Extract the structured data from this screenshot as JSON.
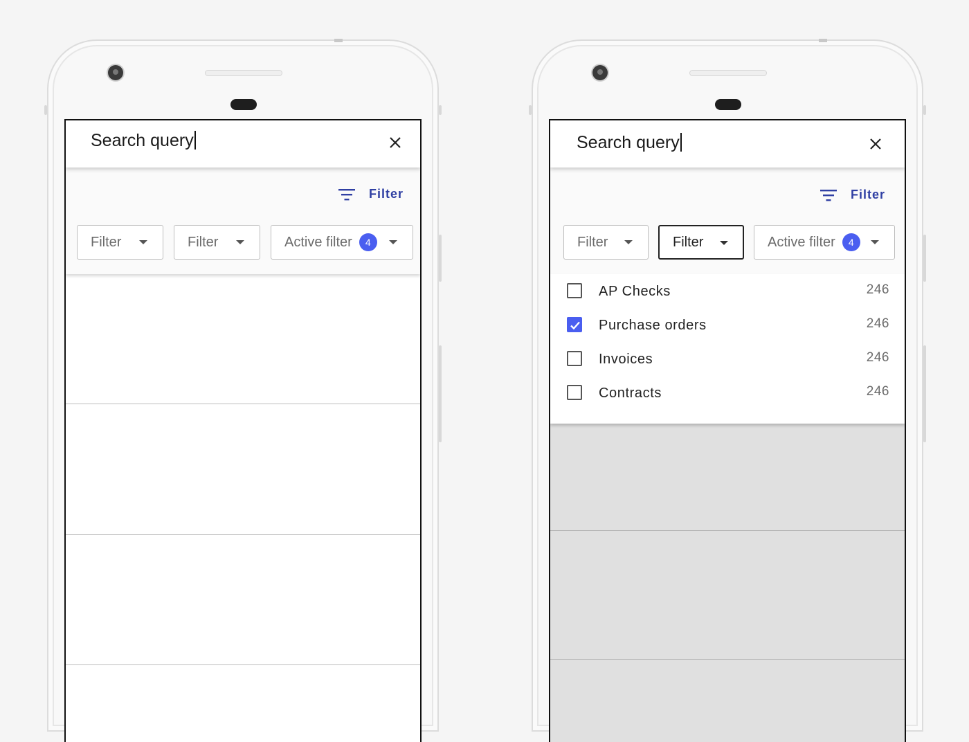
{
  "left_phone": {
    "search": {
      "query": "Search query"
    },
    "filter_link": {
      "label": "Filter",
      "icon": "filter-list-icon"
    },
    "chips": [
      {
        "label": "Filter"
      },
      {
        "label": "Filter"
      },
      {
        "label": "Active filter",
        "badge": "4"
      }
    ]
  },
  "right_phone": {
    "search": {
      "query": "Search query"
    },
    "filter_link": {
      "label": "Filter",
      "icon": "filter-list-icon"
    },
    "chips": [
      {
        "label": "Filter"
      },
      {
        "label": "Filter",
        "state": "open"
      },
      {
        "label": "Active filter",
        "badge": "4"
      }
    ],
    "options": [
      {
        "label": "AP Checks",
        "count": "246",
        "checked": false
      },
      {
        "label": "Purchase orders",
        "count": "246",
        "checked": true
      },
      {
        "label": "Invoices",
        "count": "246",
        "checked": false
      },
      {
        "label": "Contracts",
        "count": "246",
        "checked": false
      }
    ]
  },
  "colors": {
    "accent": "#4a5ef0",
    "link": "#2f3fa3",
    "scrim": "#e0e0e0"
  }
}
